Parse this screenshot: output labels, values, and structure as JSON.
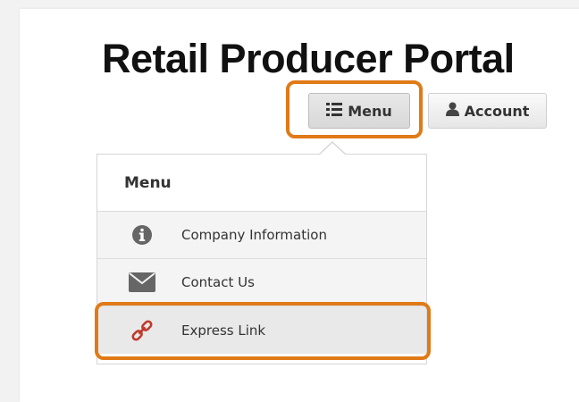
{
  "header": {
    "title": "Retail Producer Portal"
  },
  "toolbar": {
    "menu_label": "Menu",
    "menu_icon": "list-icon",
    "account_label": "Account",
    "account_icon": "user-icon"
  },
  "menu_panel": {
    "header": "Menu",
    "items": [
      {
        "label": "Company Information",
        "icon": "info-circle-icon"
      },
      {
        "label": "Contact Us",
        "icon": "envelope-icon"
      },
      {
        "label": "Express Link",
        "icon": "link-icon"
      }
    ]
  },
  "colors": {
    "highlight": "#e07a17",
    "link_icon": "#c0392b",
    "icon_gray": "#666666"
  }
}
